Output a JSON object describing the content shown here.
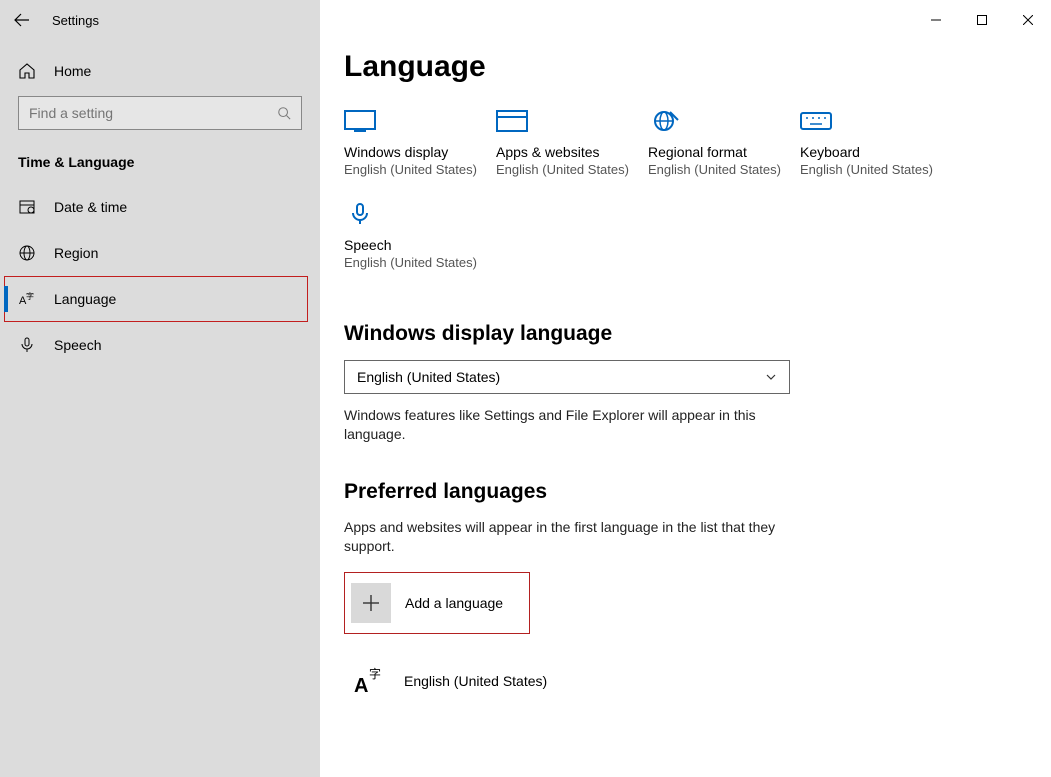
{
  "app_title": "Settings",
  "sidebar": {
    "home": "Home",
    "search_placeholder": "Find a setting",
    "category": "Time & Language",
    "items": [
      {
        "label": "Date & time"
      },
      {
        "label": "Region"
      },
      {
        "label": "Language"
      },
      {
        "label": "Speech"
      }
    ]
  },
  "page": {
    "title": "Language",
    "tiles": [
      {
        "label": "Windows display",
        "detail": "English (United States)"
      },
      {
        "label": "Apps & websites",
        "detail": "English (United States)"
      },
      {
        "label": "Regional format",
        "detail": "English (United States)"
      },
      {
        "label": "Keyboard",
        "detail": "English (United States)"
      },
      {
        "label": "Speech",
        "detail": "English (United States)"
      }
    ],
    "display_heading": "Windows display language",
    "display_value": "English (United States)",
    "display_help": "Windows features like Settings and File Explorer will appear in this language.",
    "preferred_heading": "Preferred languages",
    "preferred_help": "Apps and websites will appear in the first language in the list that they support.",
    "add_label": "Add a language",
    "languages": [
      {
        "name": "English (United States)"
      }
    ]
  }
}
